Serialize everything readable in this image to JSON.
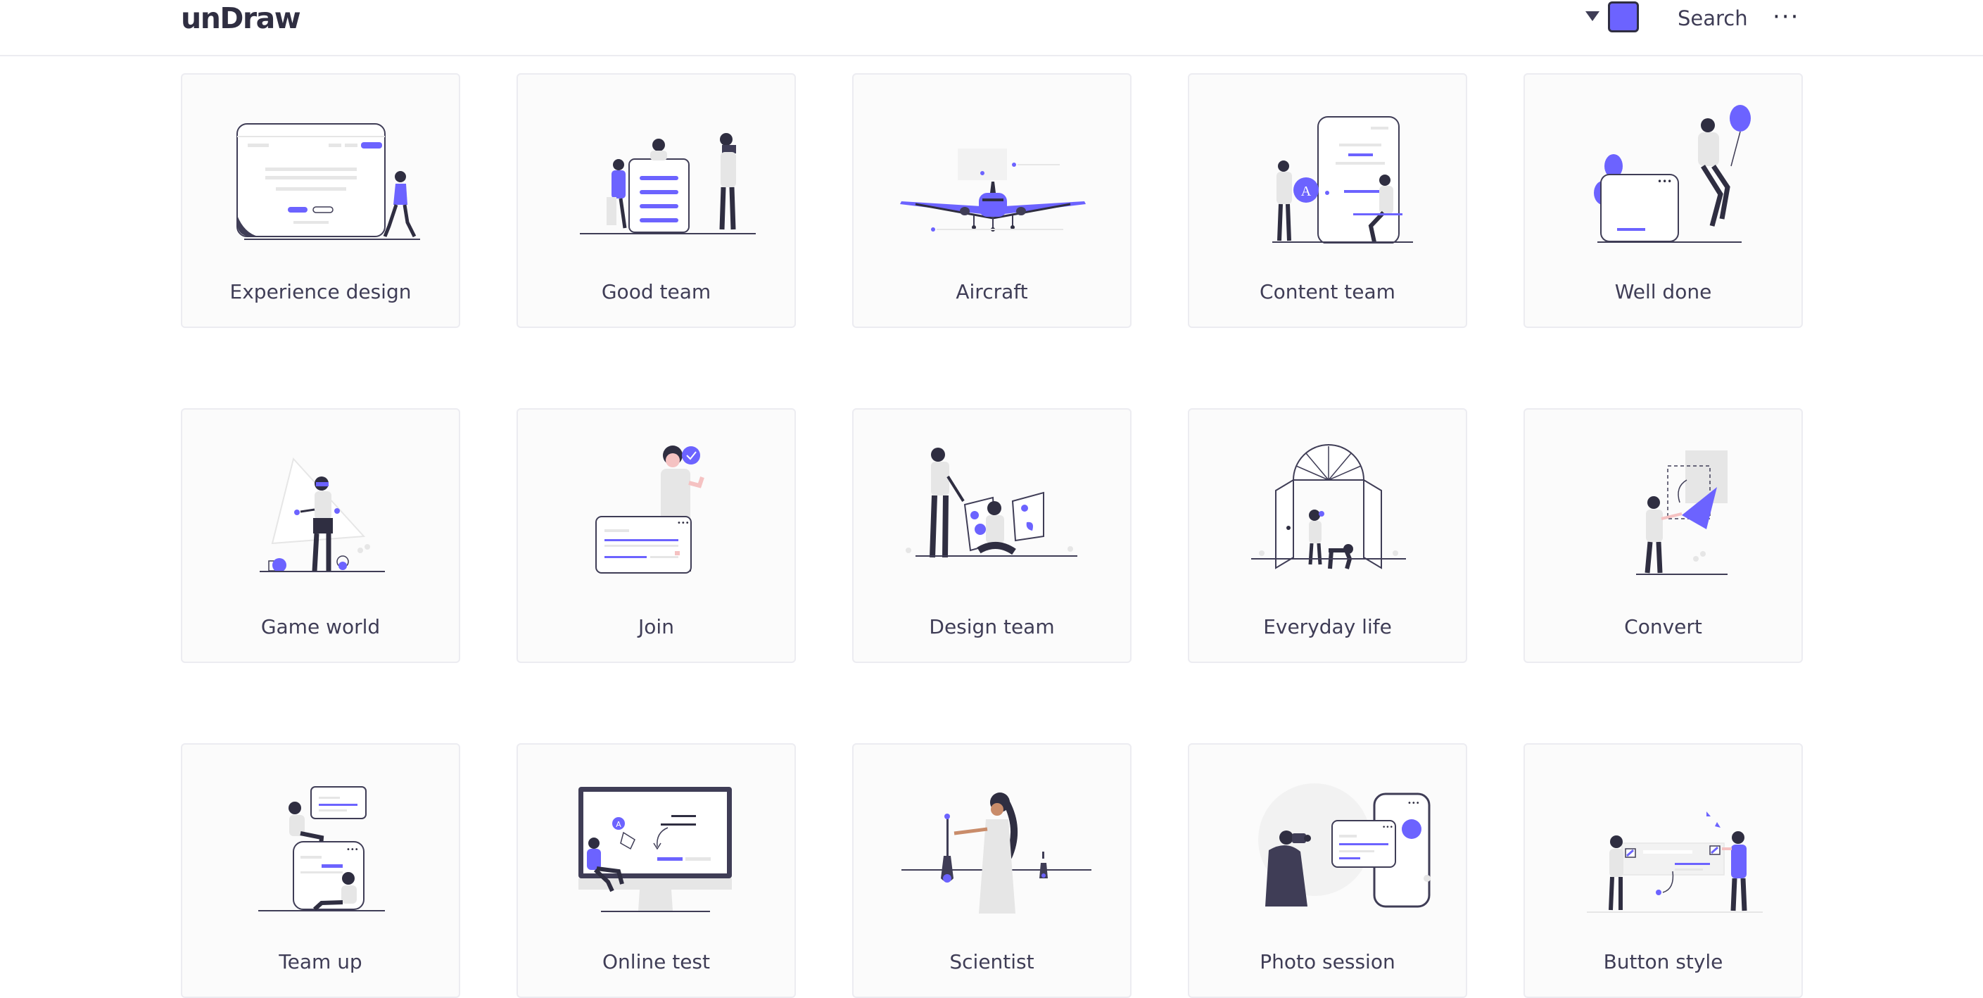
{
  "header": {
    "logo": "unDraw",
    "accent_color": "#6c63ff",
    "search_label": "Search",
    "more_icon": "more-horizontal-icon",
    "more_glyph": "···"
  },
  "illustrations": [
    {
      "title": "Experience design"
    },
    {
      "title": "Good team"
    },
    {
      "title": "Aircraft"
    },
    {
      "title": "Content team"
    },
    {
      "title": "Well done"
    },
    {
      "title": "Game world"
    },
    {
      "title": "Join"
    },
    {
      "title": "Design team"
    },
    {
      "title": "Everyday life"
    },
    {
      "title": "Convert"
    },
    {
      "title": "Team up"
    },
    {
      "title": "Online test"
    },
    {
      "title": "Scientist"
    },
    {
      "title": "Photo session"
    },
    {
      "title": "Button style"
    }
  ]
}
